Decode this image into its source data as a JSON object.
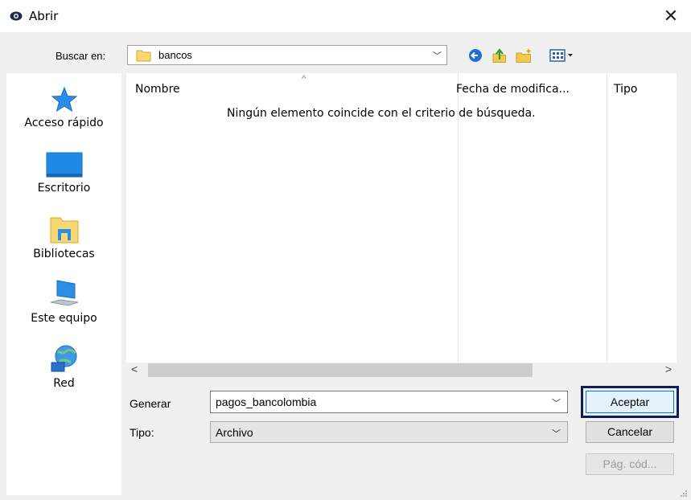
{
  "window": {
    "title": "Abrir",
    "close_symbol": "✕"
  },
  "look_in": {
    "label": "Buscar en:",
    "value": "bancos"
  },
  "places": [
    {
      "label": "Acceso rápido",
      "icon": "star-icon"
    },
    {
      "label": "Escritorio",
      "icon": "desktop-icon"
    },
    {
      "label": "Bibliotecas",
      "icon": "libraries-icon"
    },
    {
      "label": "Este equipo",
      "icon": "computer-icon"
    },
    {
      "label": "Red",
      "icon": "network-icon"
    }
  ],
  "file_list": {
    "columns": [
      "Nombre",
      "Fecha de modifica...",
      "Tipo"
    ],
    "sort_indicator": "^",
    "empty_message": "Ningún elemento coincide con el criterio de búsqueda.",
    "scroll_left": "<",
    "scroll_right": ">"
  },
  "file_name": {
    "label": "Generar",
    "value": "pagos_bancolombia"
  },
  "file_type": {
    "label": "Tipo:",
    "value": "Archivo"
  },
  "buttons": {
    "accept": "Aceptar",
    "cancel": "Cancelar",
    "code_page": "Pág. cód..."
  },
  "colors": {
    "accent_blue": "#0078d7",
    "focus_frame": "#0a1f5c",
    "folder_yellow": "#f8d775"
  }
}
